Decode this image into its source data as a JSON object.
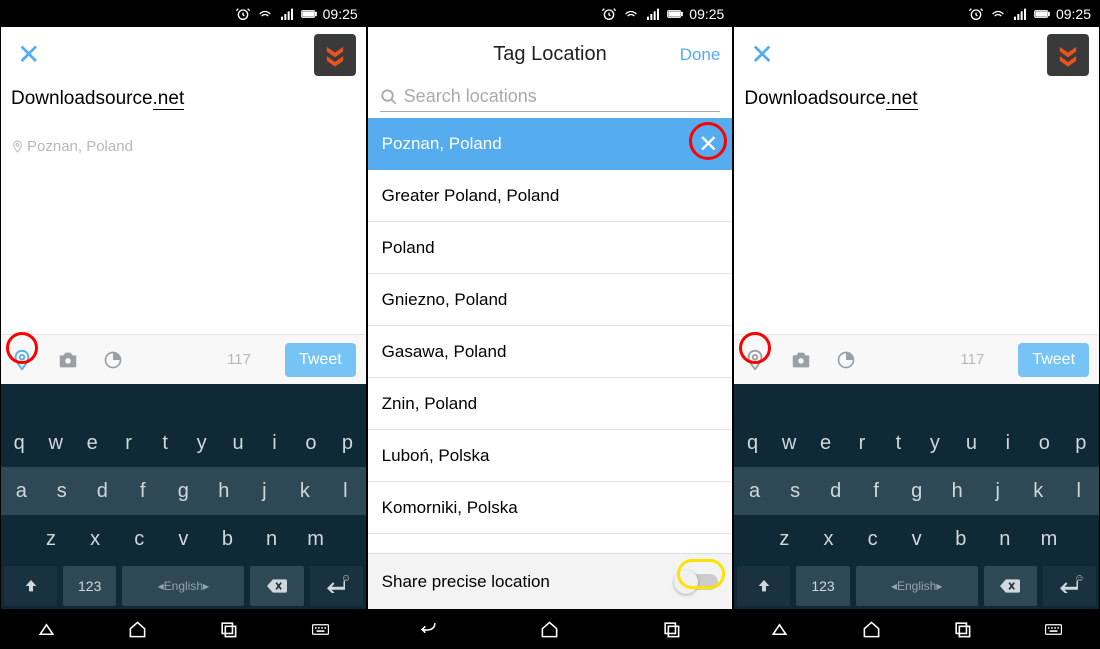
{
  "status": {
    "time": "09:25"
  },
  "compose": {
    "text_prefix": "Downloadsource",
    "text_suffix": ".net",
    "location_hint": "Poznan, Poland",
    "char_count": "117",
    "tweet_label": "Tweet"
  },
  "keyboard": {
    "row1": [
      "q",
      "w",
      "e",
      "r",
      "t",
      "y",
      "u",
      "i",
      "o",
      "p"
    ],
    "row2": [
      "a",
      "s",
      "d",
      "f",
      "g",
      "h",
      "j",
      "k",
      "l"
    ],
    "row3": [
      "z",
      "x",
      "c",
      "v",
      "b",
      "n",
      "m"
    ],
    "num_label": "123",
    "lang_label": "English"
  },
  "tag": {
    "title": "Tag Location",
    "done": "Done",
    "search_placeholder": "Search locations",
    "selected": "Poznan, Poland",
    "items": [
      "Greater Poland, Poland",
      "Poland",
      "Gniezno, Poland",
      "Gasawa, Poland",
      "Znin, Poland",
      "Luboń, Polska",
      "Komorniki, Polska"
    ],
    "share_label": "Share precise location"
  }
}
